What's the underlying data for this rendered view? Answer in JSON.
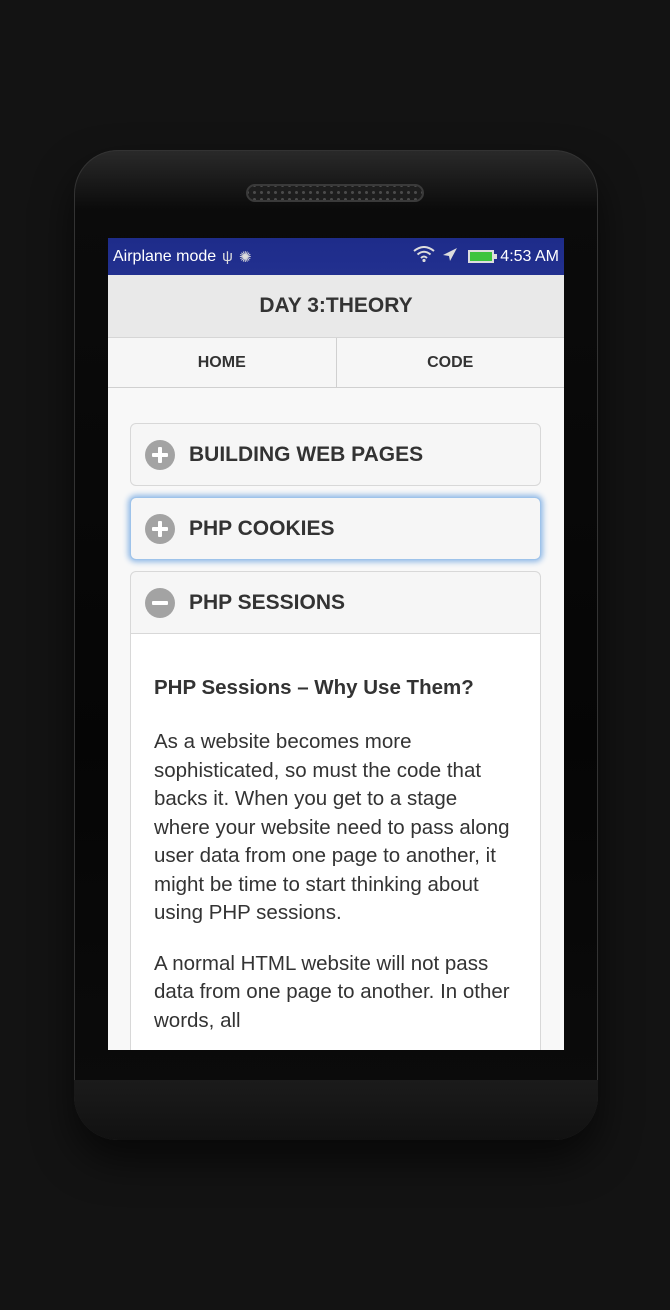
{
  "status_bar": {
    "left_text": "Airplane mode",
    "time": "4:53 AM",
    "icons": [
      "usb-icon",
      "android-debug-icon",
      "wifi-icon",
      "airplane-icon",
      "battery-icon"
    ]
  },
  "header": {
    "title": "DAY 3:THEORY"
  },
  "nav": {
    "home_label": "HOME",
    "code_label": "CODE"
  },
  "accordion": [
    {
      "title": "BUILDING WEB PAGES",
      "state": "collapsed"
    },
    {
      "title": "PHP COOKIES",
      "state": "collapsed"
    },
    {
      "title": "PHP SESSIONS",
      "state": "expanded",
      "heading": "PHP Sessions – Why Use Them?",
      "paragraphs": [
        "As a website becomes more sophisticated, so must the code that backs it. When you get to a stage where your website need to pass along user data from one page to another, it might be time to start thinking about using PHP sessions.",
        "A normal HTML website will not pass data from one page to another. In other words, all"
      ]
    }
  ],
  "colors": {
    "status_bar": "#22308f",
    "focus_ring": "#8fb8e6",
    "battery": "#3cc43c"
  }
}
